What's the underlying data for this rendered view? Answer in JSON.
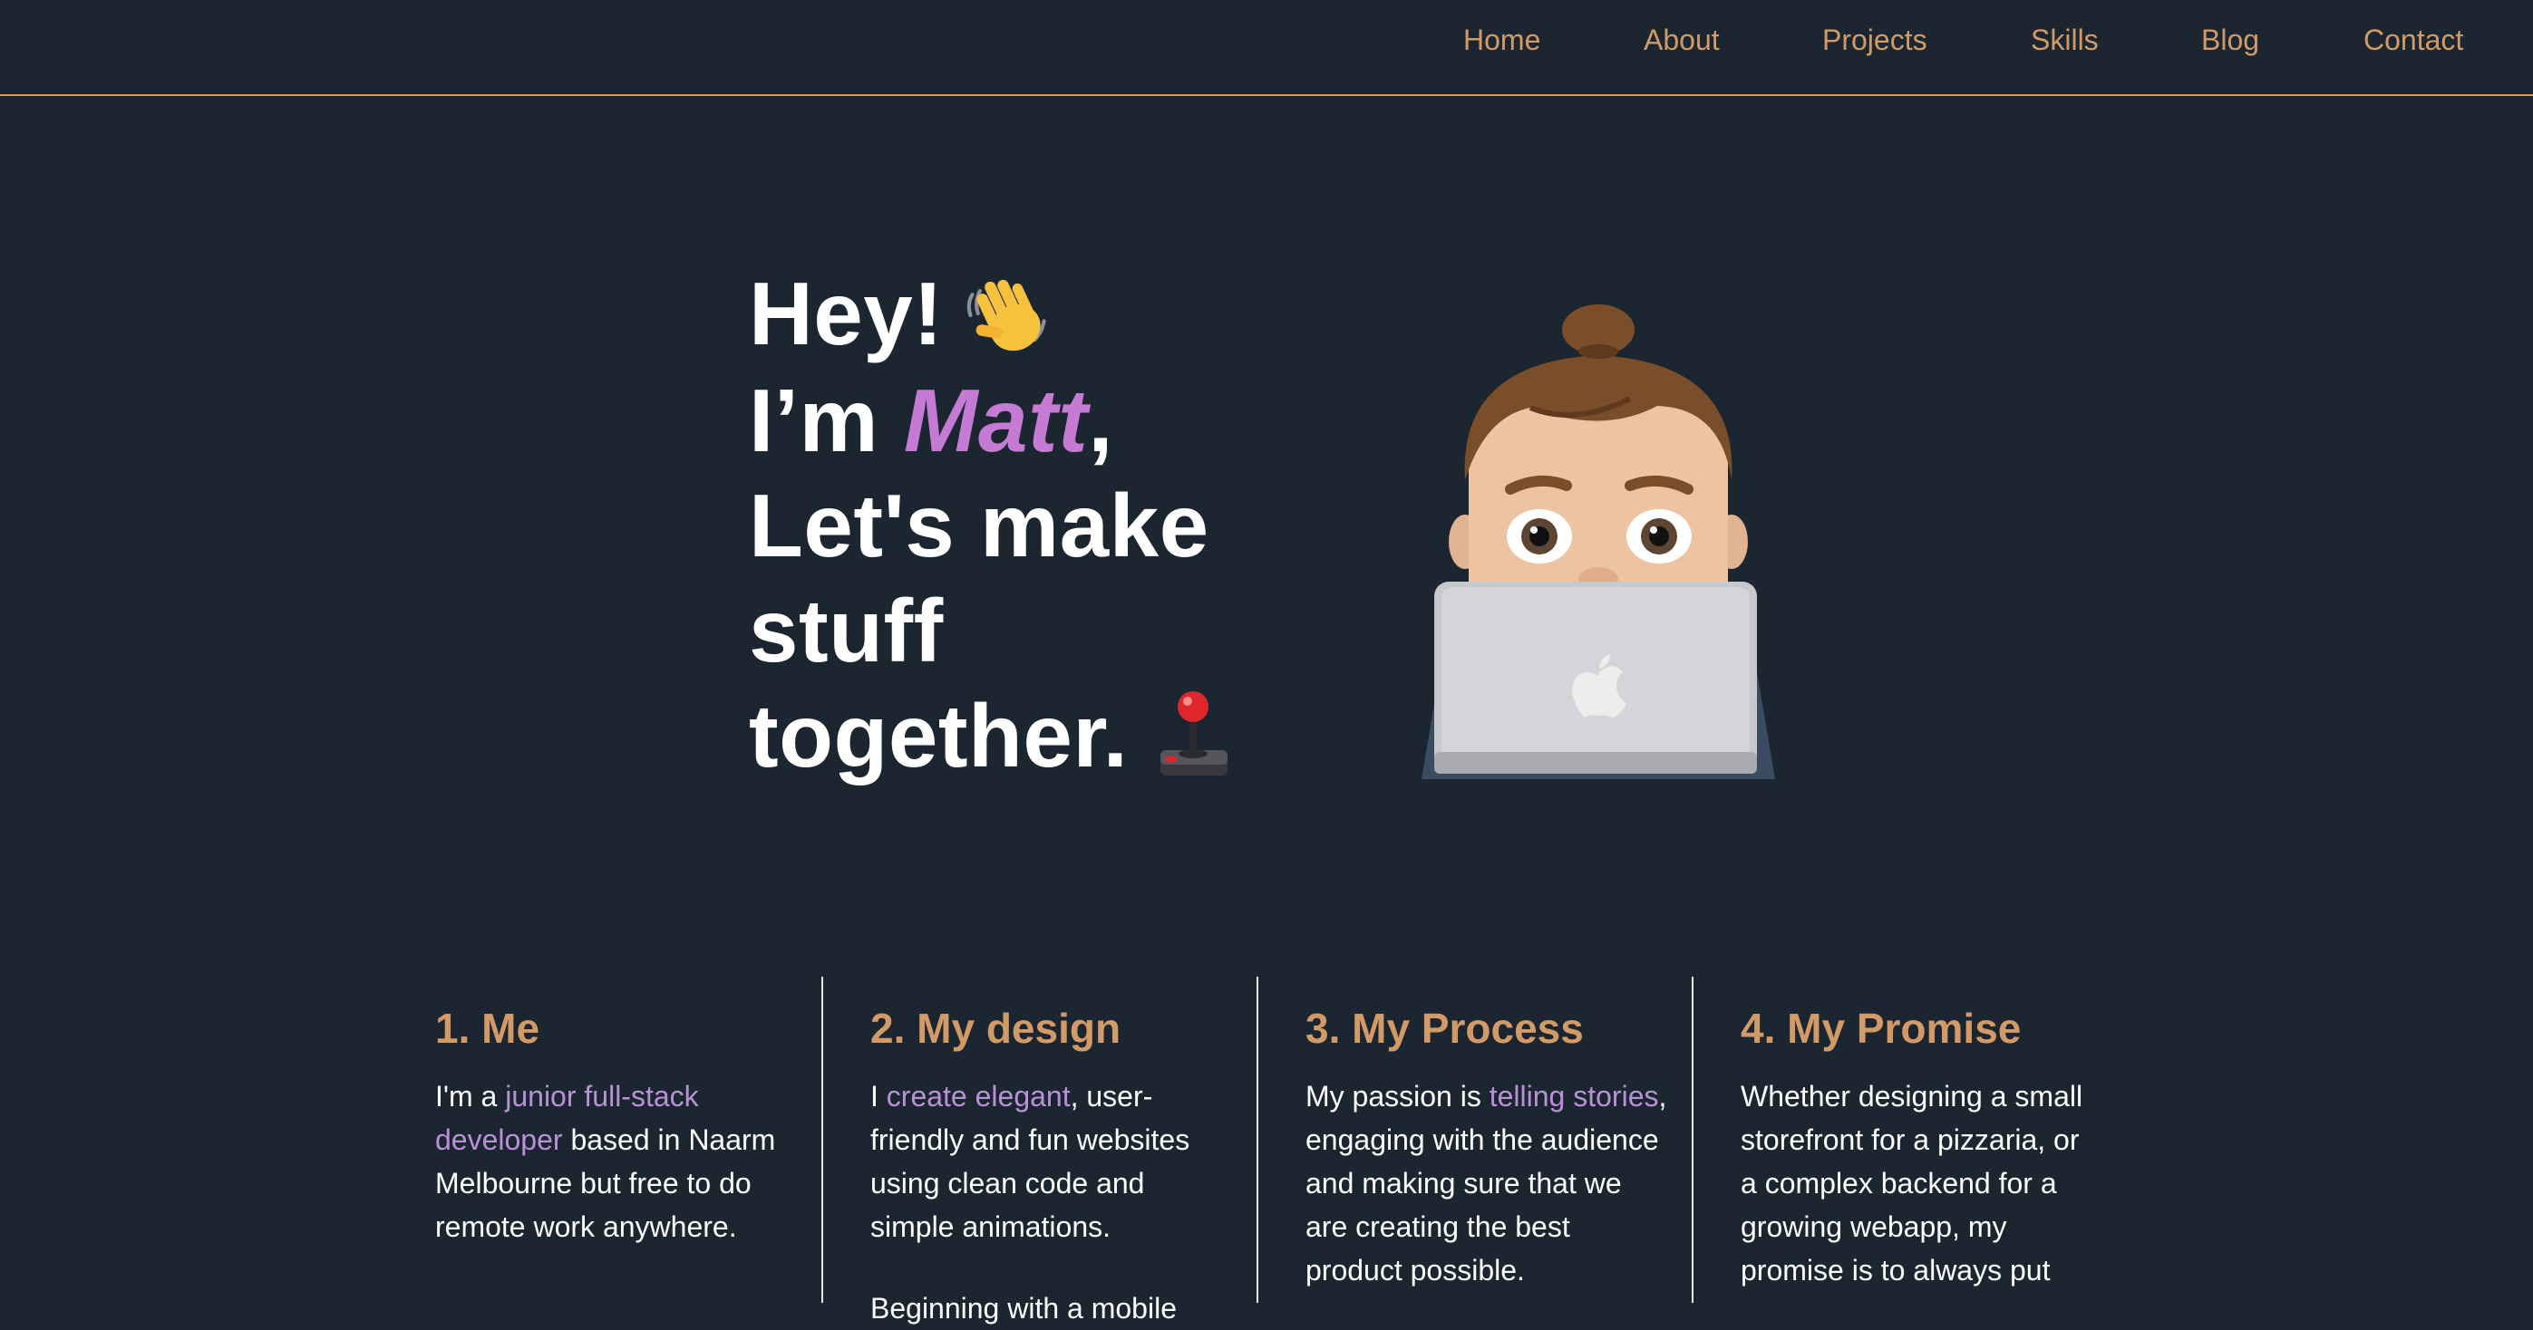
{
  "nav": {
    "items": [
      "Home",
      "About",
      "Projects",
      "Skills",
      "Blog",
      "Contact"
    ]
  },
  "hero": {
    "line1": "Hey!",
    "line2_prefix": "I’m ",
    "name": "Matt",
    "line2_suffix": ",",
    "line3": "Let's make",
    "line4": "stuff",
    "line5": "together.",
    "icons": [
      "waving-hand-icon",
      "joystick-icon",
      "memoji-laptop-avatar"
    ]
  },
  "columns": [
    {
      "title": "1. Me",
      "parts": [
        {
          "text": "I'm a ",
          "highlight": false
        },
        {
          "text": "junior full-stack developer",
          "highlight": true
        },
        {
          "text": " based in Naarm Melbourne but free to do remote work anywhere.",
          "highlight": false
        }
      ],
      "extra": ""
    },
    {
      "title": "2. My design",
      "parts": [
        {
          "text": "I ",
          "highlight": false
        },
        {
          "text": "create elegant",
          "highlight": true
        },
        {
          "text": ", user-friendly and fun websites using clean code and simple animations.",
          "highlight": false
        }
      ],
      "extra": "Beginning with a mobile"
    },
    {
      "title": "3. My Process",
      "parts": [
        {
          "text": "My passion is ",
          "highlight": false
        },
        {
          "text": "telling stories",
          "highlight": true
        },
        {
          "text": ", engaging with the audience and making sure that we are creating the best product possible.",
          "highlight": false
        }
      ],
      "extra": ""
    },
    {
      "title": "4. My Promise",
      "parts": [
        {
          "text": "Whether designing a small storefront for a pizzaria, or a complex backend for a growing webapp, my promise is to always put",
          "highlight": false
        }
      ],
      "extra": ""
    }
  ],
  "colors": {
    "background": "#1b2631",
    "accent": "#d19a66",
    "name": "#c57ad3",
    "highlight": "#b992d6",
    "text": "#ffffff"
  }
}
